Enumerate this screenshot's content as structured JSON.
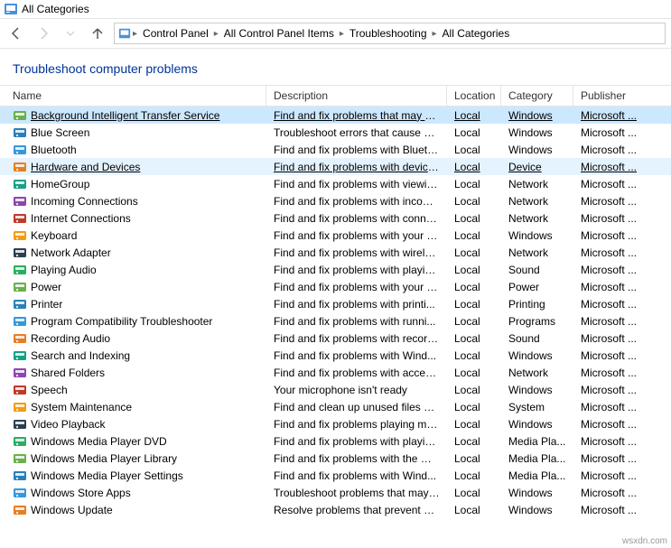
{
  "window": {
    "title": "All Categories"
  },
  "breadcrumb": {
    "items": [
      "Control Panel",
      "All Control Panel Items",
      "Troubleshooting",
      "All Categories"
    ]
  },
  "heading": "Troubleshoot computer problems",
  "columns": {
    "name": "Name",
    "description": "Description",
    "location": "Location",
    "category": "Category",
    "publisher": "Publisher"
  },
  "items": [
    {
      "name": "Background Intelligent Transfer Service",
      "description": "Find and fix problems that may p...",
      "location": "Local",
      "category": "Windows",
      "publisher": "Microsoft ...",
      "state": "selected"
    },
    {
      "name": "Blue Screen",
      "description": "Troubleshoot errors that cause Wi...",
      "location": "Local",
      "category": "Windows",
      "publisher": "Microsoft ..."
    },
    {
      "name": "Bluetooth",
      "description": "Find and fix problems with Blueto...",
      "location": "Local",
      "category": "Windows",
      "publisher": "Microsoft ..."
    },
    {
      "name": "Hardware and Devices",
      "description": "Find and fix problems with device...",
      "location": "Local",
      "category": "Device",
      "publisher": "Microsoft ...",
      "state": "hover"
    },
    {
      "name": "HomeGroup",
      "description": "Find and fix problems with viewin...",
      "location": "Local",
      "category": "Network",
      "publisher": "Microsoft ..."
    },
    {
      "name": "Incoming Connections",
      "description": "Find and fix problems with incom...",
      "location": "Local",
      "category": "Network",
      "publisher": "Microsoft ..."
    },
    {
      "name": "Internet Connections",
      "description": "Find and fix problems with conne...",
      "location": "Local",
      "category": "Network",
      "publisher": "Microsoft ..."
    },
    {
      "name": "Keyboard",
      "description": "Find and fix problems with your c...",
      "location": "Local",
      "category": "Windows",
      "publisher": "Microsoft ..."
    },
    {
      "name": "Network Adapter",
      "description": "Find and fix problems with wirele...",
      "location": "Local",
      "category": "Network",
      "publisher": "Microsoft ..."
    },
    {
      "name": "Playing Audio",
      "description": "Find and fix problems with playin...",
      "location": "Local",
      "category": "Sound",
      "publisher": "Microsoft ..."
    },
    {
      "name": "Power",
      "description": "Find and fix problems with your c...",
      "location": "Local",
      "category": "Power",
      "publisher": "Microsoft ..."
    },
    {
      "name": "Printer",
      "description": "Find and fix problems with printi...",
      "location": "Local",
      "category": "Printing",
      "publisher": "Microsoft ..."
    },
    {
      "name": "Program Compatibility Troubleshooter",
      "description": "Find and fix problems with runni...",
      "location": "Local",
      "category": "Programs",
      "publisher": "Microsoft ..."
    },
    {
      "name": "Recording Audio",
      "description": "Find and fix problems with record...",
      "location": "Local",
      "category": "Sound",
      "publisher": "Microsoft ..."
    },
    {
      "name": "Search and Indexing",
      "description": "Find and fix problems with Wind...",
      "location": "Local",
      "category": "Windows",
      "publisher": "Microsoft ..."
    },
    {
      "name": "Shared Folders",
      "description": "Find and fix problems with access...",
      "location": "Local",
      "category": "Network",
      "publisher": "Microsoft ..."
    },
    {
      "name": "Speech",
      "description": "Your microphone isn't ready",
      "location": "Local",
      "category": "Windows",
      "publisher": "Microsoft ..."
    },
    {
      "name": "System Maintenance",
      "description": "Find and clean up unused files an...",
      "location": "Local",
      "category": "System",
      "publisher": "Microsoft ..."
    },
    {
      "name": "Video Playback",
      "description": "Find and fix problems playing mo...",
      "location": "Local",
      "category": "Windows",
      "publisher": "Microsoft ..."
    },
    {
      "name": "Windows Media Player DVD",
      "description": "Find and fix problems with playin...",
      "location": "Local",
      "category": "Media Pla...",
      "publisher": "Microsoft ..."
    },
    {
      "name": "Windows Media Player Library",
      "description": "Find and fix problems with the Wi...",
      "location": "Local",
      "category": "Media Pla...",
      "publisher": "Microsoft ..."
    },
    {
      "name": "Windows Media Player Settings",
      "description": "Find and fix problems with Wind...",
      "location": "Local",
      "category": "Media Pla...",
      "publisher": "Microsoft ..."
    },
    {
      "name": "Windows Store Apps",
      "description": "Troubleshoot problems that may ...",
      "location": "Local",
      "category": "Windows",
      "publisher": "Microsoft ..."
    },
    {
      "name": "Windows Update",
      "description": "Resolve problems that prevent yo...",
      "location": "Local",
      "category": "Windows",
      "publisher": "Microsoft ..."
    }
  ],
  "watermark": "wsxdn.com"
}
